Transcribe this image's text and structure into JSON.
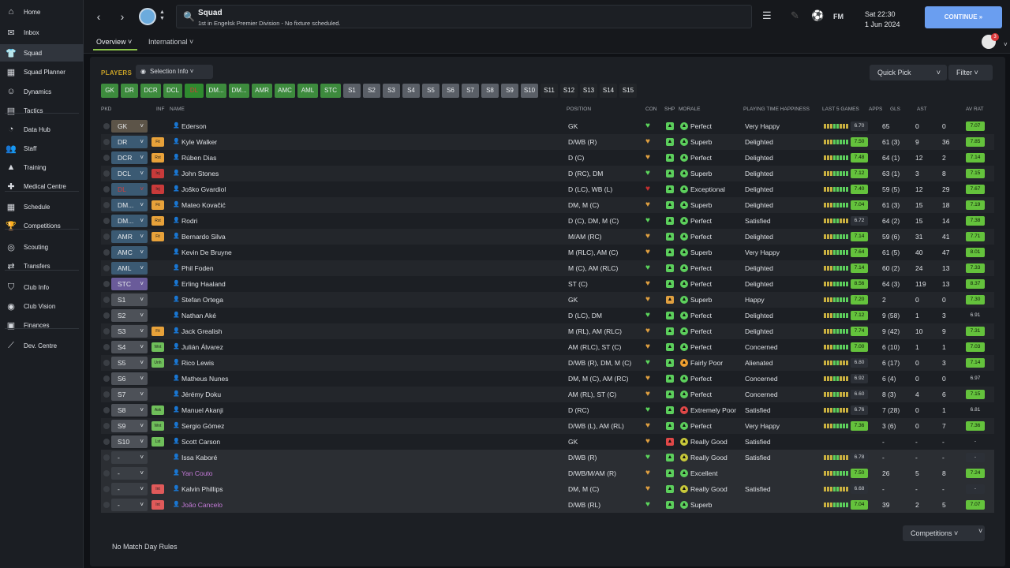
{
  "sidebar": {
    "items": [
      {
        "label": "Home",
        "icon": "home-icon",
        "glyph": "⌂"
      },
      {
        "label": "Inbox",
        "icon": "inbox-icon",
        "glyph": "✉"
      },
      {
        "label": "Squad",
        "icon": "shirt-icon",
        "glyph": "👕",
        "active": true
      },
      {
        "label": "Squad Planner",
        "icon": "planner-icon",
        "glyph": "▦"
      },
      {
        "label": "Dynamics",
        "icon": "dynamics-icon",
        "glyph": "☺"
      },
      {
        "label": "Tactics",
        "icon": "tactics-icon",
        "glyph": "▤"
      },
      {
        "label": "Data Hub",
        "icon": "data-hub-icon",
        "glyph": "◔"
      },
      {
        "label": "Staff",
        "icon": "staff-icon",
        "glyph": "👥"
      },
      {
        "label": "Training",
        "icon": "training-icon",
        "glyph": "▲"
      },
      {
        "label": "Medical Centre",
        "icon": "medical-icon",
        "glyph": "✚"
      },
      {
        "label": "Schedule",
        "icon": "calendar-icon",
        "glyph": "▦"
      },
      {
        "label": "Competitions",
        "icon": "trophy-icon",
        "glyph": "🏆"
      },
      {
        "label": "Scouting",
        "icon": "scouting-icon",
        "glyph": "◎"
      },
      {
        "label": "Transfers",
        "icon": "transfers-icon",
        "glyph": "⇄"
      },
      {
        "label": "Club Info",
        "icon": "shield-icon",
        "glyph": "⛉"
      },
      {
        "label": "Club Vision",
        "icon": "vision-icon",
        "glyph": "◉"
      },
      {
        "label": "Finances",
        "icon": "finances-icon",
        "glyph": "▣"
      },
      {
        "label": "Dev. Centre",
        "icon": "dev-centre-icon",
        "glyph": "⟋"
      }
    ]
  },
  "topbar": {
    "title": "Squad",
    "subtitle": "1st in Engelsk Premier Division - No fixture scheduled.",
    "fm_label": "FM",
    "time": "Sat 22:30",
    "date": "1 Jun 2024",
    "continue_label": "CONTINUE",
    "tabs": [
      "Overview",
      "International"
    ],
    "notif_count": "3"
  },
  "toolbar": {
    "players_label": "PLAYERS",
    "selection_info": "Selection Info",
    "quick_pick": "Quick Pick",
    "filter": "Filter",
    "positions": [
      "GK",
      "DR",
      "DCR",
      "DCL",
      "DL",
      "DM...",
      "DM...",
      "AMR",
      "AMC",
      "AML",
      "STC",
      "S1",
      "S2",
      "S3",
      "S4",
      "S5",
      "S6",
      "S7",
      "S8",
      "S9",
      "S10",
      "S11",
      "S12",
      "S13",
      "S14",
      "S15"
    ]
  },
  "columns": {
    "pkd": "PKD",
    "inf": "INF",
    "name": "NAME",
    "position": "POSITION",
    "con": "CON",
    "shp": "SHP",
    "morale": "MORALE",
    "pth": "PLAYING TIME HAPPINESS",
    "last5": "LAST 5 GAMES",
    "apps": "APPS",
    "gls": "GLS",
    "ast": "AST",
    "avrat": "AV RAT"
  },
  "players": [
    {
      "slot": "GK",
      "inf": "",
      "name": "Ederson",
      "pos": "GK",
      "morale": "Perfect",
      "pth": "Very Happy",
      "last5": "6.70",
      "apps": "65",
      "gls": "0",
      "ast": "0",
      "avrat": "7.07"
    },
    {
      "slot": "DR",
      "inf": "Fit",
      "name": "Kyle Walker",
      "pos": "D/WB (R)",
      "morale": "Superb",
      "pth": "Delighted",
      "last5": "7.50",
      "apps": "61 (3)",
      "gls": "9",
      "ast": "36",
      "avrat": "7.85"
    },
    {
      "slot": "DCR",
      "inf": "Rst",
      "name": "Rúben Dias",
      "pos": "D (C)",
      "morale": "Perfect",
      "pth": "Delighted",
      "last5": "7.48",
      "apps": "64 (1)",
      "gls": "12",
      "ast": "2",
      "avrat": "7.14"
    },
    {
      "slot": "DCL",
      "inf": "Inj",
      "name": "John Stones",
      "pos": "D (RC), DM",
      "morale": "Superb",
      "pth": "Delighted",
      "last5": "7.12",
      "apps": "63 (1)",
      "gls": "3",
      "ast": "8",
      "avrat": "7.15"
    },
    {
      "slot": "DL",
      "inf": "Inj",
      "name": "Joško Gvardiol",
      "pos": "D (LC), WB (L)",
      "morale": "Exceptional",
      "pth": "Delighted",
      "last5": "7.40",
      "apps": "59 (5)",
      "gls": "12",
      "ast": "29",
      "avrat": "7.67"
    },
    {
      "slot": "DM...",
      "inf": "Fit",
      "name": "Mateo Kovačić",
      "pos": "DM, M (C)",
      "morale": "Superb",
      "pth": "Delighted",
      "last5": "7.04",
      "apps": "61 (3)",
      "gls": "15",
      "ast": "18",
      "avrat": "7.19"
    },
    {
      "slot": "DM...",
      "inf": "Rst",
      "name": "Rodri",
      "pos": "D (C), DM, M (C)",
      "morale": "Perfect",
      "pth": "Satisfied",
      "last5": "6.72",
      "apps": "64 (2)",
      "gls": "15",
      "ast": "14",
      "avrat": "7.38"
    },
    {
      "slot": "AMR",
      "inf": "Fit",
      "name": "Bernardo Silva",
      "pos": "M/AM (RC)",
      "morale": "Perfect",
      "pth": "Delighted",
      "last5": "7.14",
      "apps": "59 (6)",
      "gls": "31",
      "ast": "41",
      "avrat": "7.71"
    },
    {
      "slot": "AMC",
      "inf": "",
      "name": "Kevin De Bruyne",
      "pos": "M (RLC), AM (C)",
      "morale": "Superb",
      "pth": "Very Happy",
      "last5": "7.64",
      "apps": "61 (5)",
      "gls": "40",
      "ast": "47",
      "avrat": "8.01"
    },
    {
      "slot": "AML",
      "inf": "",
      "name": "Phil Foden",
      "pos": "M (C), AM (RLC)",
      "morale": "Perfect",
      "pth": "Delighted",
      "last5": "7.14",
      "apps": "60 (2)",
      "gls": "24",
      "ast": "13",
      "avrat": "7.33"
    },
    {
      "slot": "STC",
      "inf": "",
      "name": "Erling Haaland",
      "pos": "ST (C)",
      "morale": "Perfect",
      "pth": "Delighted",
      "last5": "8.56",
      "apps": "64 (3)",
      "gls": "119",
      "ast": "13",
      "avrat": "8.37"
    },
    {
      "slot": "S1",
      "inf": "",
      "name": "Stefan Ortega",
      "pos": "GK",
      "morale": "Superb",
      "pth": "Happy",
      "last5": "7.20",
      "apps": "2",
      "gls": "0",
      "ast": "0",
      "avrat": "7.30"
    },
    {
      "slot": "S2",
      "inf": "",
      "name": "Nathan Aké",
      "pos": "D (LC), DM",
      "morale": "Perfect",
      "pth": "Delighted",
      "last5": "7.12",
      "apps": "9 (58)",
      "gls": "1",
      "ast": "3",
      "avrat": "6.91"
    },
    {
      "slot": "S3",
      "inf": "Fit",
      "name": "Jack Grealish",
      "pos": "M (RL), AM (RLC)",
      "morale": "Perfect",
      "pth": "Delighted",
      "last5": "7.74",
      "apps": "9 (42)",
      "gls": "10",
      "ast": "9",
      "avrat": "7.31"
    },
    {
      "slot": "S4",
      "inf": "Wnt",
      "name": "Julián Álvarez",
      "pos": "AM (RLC), ST (C)",
      "morale": "Perfect",
      "pth": "Concerned",
      "last5": "7.00",
      "apps": "6 (10)",
      "gls": "1",
      "ast": "1",
      "avrat": "7.03"
    },
    {
      "slot": "S5",
      "inf": "Unh",
      "name": "Rico Lewis",
      "pos": "D/WB (R), DM, M (C)",
      "morale": "Fairly Poor",
      "pth": "Alienated",
      "last5": "6.80",
      "apps": "6 (17)",
      "gls": "0",
      "ast": "3",
      "avrat": "7.14"
    },
    {
      "slot": "S6",
      "inf": "",
      "name": "Matheus Nunes",
      "pos": "DM, M (C), AM (RC)",
      "morale": "Perfect",
      "pth": "Concerned",
      "last5": "6.92",
      "apps": "6 (4)",
      "gls": "0",
      "ast": "0",
      "avrat": "6.97"
    },
    {
      "slot": "S7",
      "inf": "",
      "name": "Jérémy Doku",
      "pos": "AM (RL), ST (C)",
      "morale": "Perfect",
      "pth": "Concerned",
      "last5": "6.60",
      "apps": "8 (3)",
      "gls": "4",
      "ast": "6",
      "avrat": "7.15"
    },
    {
      "slot": "S8",
      "inf": "Ask",
      "name": "Manuel Akanji",
      "pos": "D (RC)",
      "morale": "Extremely Poor",
      "pth": "Satisfied",
      "last5": "6.76",
      "apps": "7 (28)",
      "gls": "0",
      "ast": "1",
      "avrat": "6.81"
    },
    {
      "slot": "S9",
      "inf": "Wnt",
      "name": "Sergio Gómez",
      "pos": "D/WB (L), AM (RL)",
      "morale": "Perfect",
      "pth": "Very Happy",
      "last5": "7.36",
      "apps": "3 (6)",
      "gls": "0",
      "ast": "7",
      "avrat": "7.36"
    },
    {
      "slot": "S10",
      "inf": "Lst",
      "name": "Scott Carson",
      "pos": "GK",
      "morale": "Really Good",
      "pth": "Satisfied",
      "last5": "",
      "apps": "-",
      "gls": "-",
      "ast": "-",
      "avrat": "-"
    },
    {
      "slot": "-",
      "inf": "",
      "name": "Issa Kaboré",
      "pos": "D/WB (R)",
      "morale": "Really Good",
      "pth": "Satisfied",
      "last5": "6.78",
      "apps": "-",
      "gls": "-",
      "ast": "-",
      "avrat": "-"
    },
    {
      "slot": "-",
      "inf": "",
      "name": "Yan Couto",
      "pos": "D/WB/M/AM (R)",
      "morale": "Excellent",
      "pth": "",
      "last5": "7.50",
      "apps": "26",
      "gls": "5",
      "ast": "8",
      "avrat": "7.24"
    },
    {
      "slot": "-",
      "inf": "Int",
      "name": "Kalvin Phillips",
      "pos": "DM, M (C)",
      "morale": "Really Good",
      "pth": "Satisfied",
      "last5": "6.68",
      "apps": "-",
      "gls": "-",
      "ast": "-",
      "avrat": "-"
    },
    {
      "slot": "-",
      "inf": "Int",
      "name": "João Cancelo",
      "pos": "D/WB (RL)",
      "morale": "Superb",
      "pth": "",
      "last5": "7.04",
      "apps": "39",
      "gls": "2",
      "ast": "5",
      "avrat": "7.07"
    }
  ],
  "footer": {
    "competitions": "Competitions",
    "match_day": "No Match Day Rules"
  }
}
